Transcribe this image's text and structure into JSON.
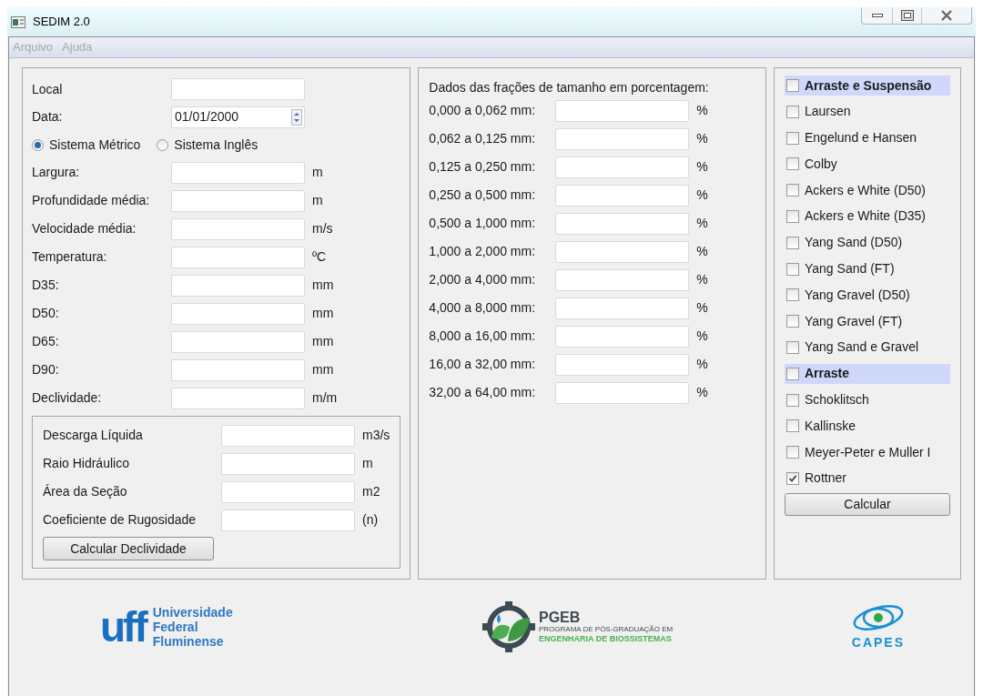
{
  "window": {
    "title": "SEDIM 2.0"
  },
  "menu": [
    "Arquivo",
    "Ajuda"
  ],
  "general": {
    "local": {
      "label": "Local"
    },
    "date": {
      "label": "Data:",
      "value": "01/01/2000"
    },
    "systems": [
      {
        "label": "Sistema Métrico",
        "selected": true
      },
      {
        "label": "Sistema Inglês",
        "selected": false
      }
    ],
    "fields": [
      {
        "label": "Largura:",
        "unit": "m"
      },
      {
        "label": "Profundidade média:",
        "unit": "m"
      },
      {
        "label": "Velocidade média:",
        "unit": "m/s"
      },
      {
        "label": "Temperatura:",
        "unit": "ºC"
      },
      {
        "label": "D35:",
        "unit": "mm"
      },
      {
        "label": "D50:",
        "unit": "mm"
      },
      {
        "label": "D65:",
        "unit": "mm"
      },
      {
        "label": "D90:",
        "unit": "mm"
      },
      {
        "label": "Declividade:",
        "unit": "m/m"
      }
    ]
  },
  "slope": {
    "fields": [
      {
        "label": "Descarga Líquida",
        "unit": "m3/s"
      },
      {
        "label": "Raio Hidráulico",
        "unit": "m"
      },
      {
        "label": "Área da Seção",
        "unit": "m2"
      },
      {
        "label": "Coeficiente de Rugosidade",
        "unit": "(n)"
      }
    ],
    "button": "Calcular Declividade"
  },
  "fractions": {
    "title": "Dados das frações de tamanho em porcentagem:",
    "rows": [
      {
        "label": "0,000 a 0,062 mm:",
        "unit": "%"
      },
      {
        "label": "0,062 a 0,125 mm:",
        "unit": "%"
      },
      {
        "label": "0,125 a 0,250 mm:",
        "unit": "%"
      },
      {
        "label": "0,250 a 0,500 mm:",
        "unit": "%"
      },
      {
        "label": "0,500 a 1,000 mm:",
        "unit": "%"
      },
      {
        "label": "1,000 a 2,000 mm:",
        "unit": "%"
      },
      {
        "label": "2,000 a 4,000 mm:",
        "unit": "%"
      },
      {
        "label": "4,000 a 8,000 mm:",
        "unit": "%"
      },
      {
        "label": "8,000 a 16,00 mm:",
        "unit": "%"
      },
      {
        "label": "16,00 a 32,00 mm:",
        "unit": "%"
      },
      {
        "label": "32,00 a 64,00 mm:",
        "unit": "%"
      }
    ]
  },
  "methods": {
    "items": [
      {
        "kind": "group",
        "label": "Arraste e Suspensão",
        "checked": false
      },
      {
        "kind": "option",
        "label": "Laursen",
        "checked": false
      },
      {
        "kind": "option",
        "label": "Engelund e Hansen",
        "checked": false
      },
      {
        "kind": "option",
        "label": "Colby",
        "checked": false
      },
      {
        "kind": "option",
        "label": "Ackers e White (D50)",
        "checked": false
      },
      {
        "kind": "option",
        "label": "Ackers e White (D35)",
        "checked": false
      },
      {
        "kind": "option",
        "label": "Yang Sand (D50)",
        "checked": false
      },
      {
        "kind": "option",
        "label": "Yang Sand (FT)",
        "checked": false
      },
      {
        "kind": "option",
        "label": "Yang Gravel (D50)",
        "checked": false
      },
      {
        "kind": "option",
        "label": "Yang Gravel (FT)",
        "checked": false
      },
      {
        "kind": "option",
        "label": "Yang Sand e Gravel",
        "checked": false
      },
      {
        "kind": "group",
        "label": "Arraste",
        "checked": false
      },
      {
        "kind": "option",
        "label": "Schoklitsch",
        "checked": false
      },
      {
        "kind": "option",
        "label": "Kallinske",
        "checked": false
      },
      {
        "kind": "option",
        "label": "Meyer-Peter e Muller I",
        "checked": false
      },
      {
        "kind": "option",
        "label": "Rottner",
        "checked": true
      }
    ],
    "button": "Calcular"
  },
  "logos": {
    "uff": {
      "mark": "uff",
      "lines": [
        "Universidade",
        "Federal",
        "Fluminense"
      ]
    },
    "pgeb": {
      "mark": "PGEB",
      "subtitle": "PROGRAMA DE PÓS-GRADUAÇÃO EM",
      "name": "ENGENHARIA DE BIOSSISTEMAS"
    },
    "capes": {
      "name": "CAPES"
    }
  }
}
